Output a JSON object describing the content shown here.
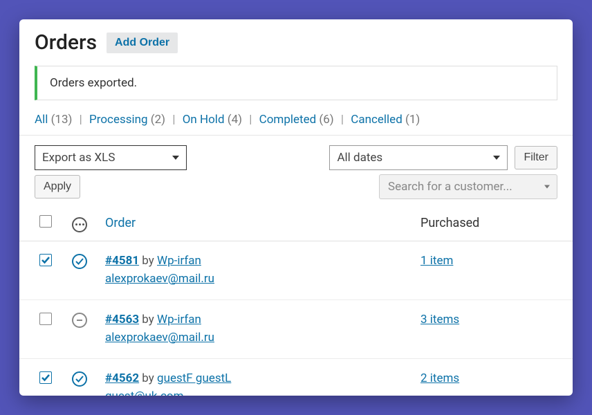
{
  "header": {
    "title": "Orders",
    "add_label": "Add Order"
  },
  "notice": {
    "message": "Orders exported."
  },
  "filters": [
    {
      "label": "All",
      "count": "(13)"
    },
    {
      "label": "Processing",
      "count": "(2)"
    },
    {
      "label": "On Hold",
      "count": "(4)"
    },
    {
      "label": "Completed",
      "count": "(6)"
    },
    {
      "label": "Cancelled",
      "count": "(1)"
    }
  ],
  "toolbar": {
    "export_option": "Export as XLS",
    "date_option": "All dates",
    "filter_btn": "Filter",
    "apply_btn": "Apply",
    "customer_search_placeholder": "Search for a customer..."
  },
  "columns": {
    "order": "Order",
    "purchased": "Purchased"
  },
  "rows": [
    {
      "checked": true,
      "status": "processing",
      "order_num": "#4581",
      "by": "by",
      "author": "Wp-irfan",
      "email": "alexprokaev@mail.ru",
      "purchased": "1 item"
    },
    {
      "checked": false,
      "status": "onhold",
      "order_num": "#4563",
      "by": "by",
      "author": "Wp-irfan",
      "email": "alexprokaev@mail.ru",
      "purchased": "3 items"
    },
    {
      "checked": true,
      "status": "processing",
      "order_num": "#4562",
      "by": "by",
      "author": "guestF guestL",
      "email": "guest@uk.com",
      "purchased": "2 items"
    }
  ]
}
